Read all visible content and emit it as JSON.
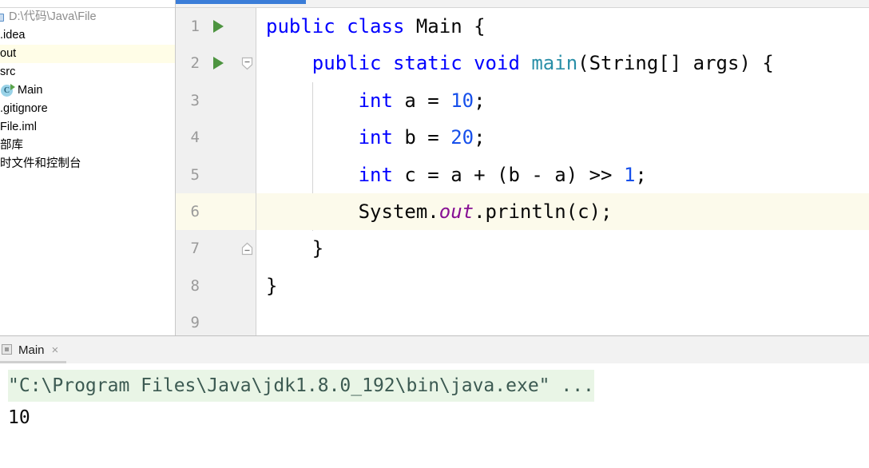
{
  "sidebar": {
    "project_root": {
      "label": "D:\\代码\\Java\\File",
      "icon": "project-folder-icon"
    },
    "items": [
      {
        "label": ".idea",
        "icon": "folder-icon",
        "selected": false
      },
      {
        "label": "out",
        "icon": "folder-icon",
        "selected": true
      },
      {
        "label": "src",
        "icon": "folder-icon",
        "selected": false
      },
      {
        "label": "Main",
        "icon": "java-class-icon",
        "selected": false
      },
      {
        "label": ".gitignore",
        "icon": "file-icon",
        "selected": false
      },
      {
        "label": "File.iml",
        "icon": "file-icon",
        "selected": false
      },
      {
        "label": "部库",
        "icon": "library-icon",
        "selected": false
      },
      {
        "label": "时文件和控制台",
        "icon": "scratch-icon",
        "selected": false
      }
    ]
  },
  "editor": {
    "active_tab_accent": "#3b7dd8",
    "current_line": 6,
    "lines": [
      {
        "num": "1",
        "run_arrow": true,
        "fold": "none",
        "highlight": false
      },
      {
        "num": "2",
        "run_arrow": true,
        "fold": "open",
        "highlight": false
      },
      {
        "num": "3",
        "run_arrow": false,
        "fold": "none",
        "highlight": false
      },
      {
        "num": "4",
        "run_arrow": false,
        "fold": "none",
        "highlight": false
      },
      {
        "num": "5",
        "run_arrow": false,
        "fold": "none",
        "highlight": false
      },
      {
        "num": "6",
        "run_arrow": false,
        "fold": "none",
        "highlight": true
      },
      {
        "num": "7",
        "run_arrow": false,
        "fold": "close",
        "highlight": false
      },
      {
        "num": "8",
        "run_arrow": false,
        "fold": "none",
        "highlight": false
      },
      {
        "num": "9",
        "run_arrow": false,
        "fold": "none",
        "highlight": false
      }
    ],
    "code": {
      "l1": {
        "kw1": "public",
        "kw2": "class",
        "name": "Main",
        "brace": "{"
      },
      "l2": {
        "kw1": "public",
        "kw2": "static",
        "kw3": "void",
        "name": "main",
        "params": "(String[] args) {"
      },
      "l3": {
        "kw": "int",
        "rest_a": " a = ",
        "num": "10",
        "rest_b": ";"
      },
      "l4": {
        "kw": "int",
        "rest_a": " b = ",
        "num": "20",
        "rest_b": ";"
      },
      "l5": {
        "kw": "int",
        "rest_a": " c = a + (b - a) >> ",
        "num": "1",
        "rest_b": ";"
      },
      "l6": {
        "pre": "System.",
        "field": "out",
        "post": ".println(c);"
      },
      "l7": {
        "brace": "}"
      },
      "l8": {
        "brace": "}"
      },
      "l9": {
        "text": ""
      }
    },
    "colors": {
      "keyword": "#0000ff",
      "number": "#1750eb",
      "method": "#2a8fa8",
      "field": "#871094",
      "current_line_bg": "#fcfaeb",
      "gutter_bg": "#f0f0f0"
    }
  },
  "console": {
    "tab": {
      "label": "Main",
      "close_glyph": "×",
      "icon": "run-config-icon"
    },
    "lines": [
      {
        "text": "\"C:\\Program Files\\Java\\jdk1.8.0_192\\bin\\java.exe\" ...",
        "kind": "command"
      },
      {
        "text": "10",
        "kind": "output"
      }
    ],
    "command_bg": "#e9f5e6"
  }
}
